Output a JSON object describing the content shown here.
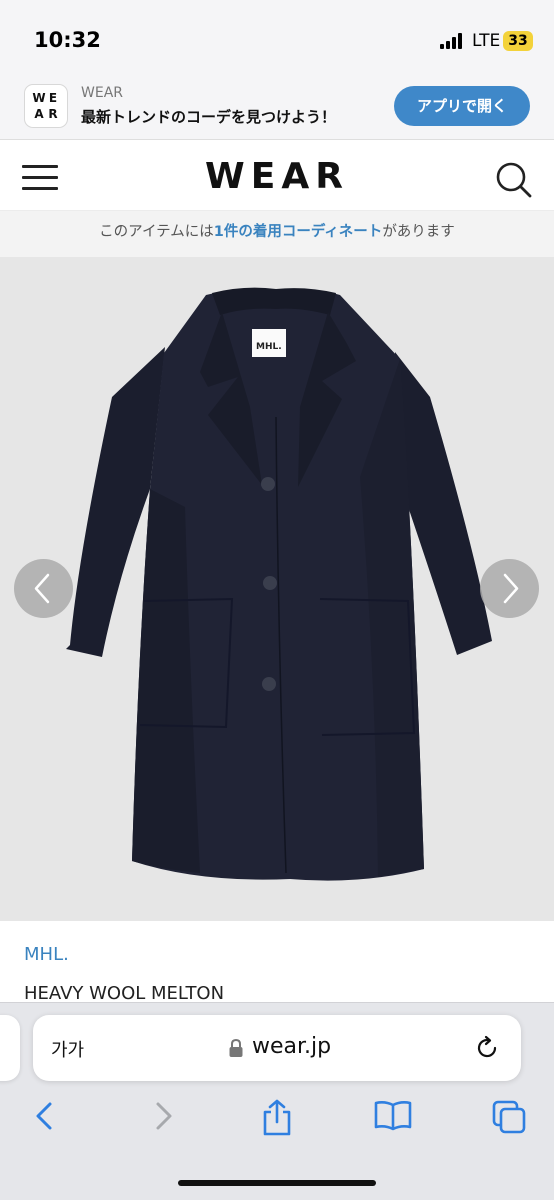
{
  "status_bar": {
    "time": "10:32",
    "network": "LTE",
    "battery": "33"
  },
  "app_banner": {
    "logo_letters": [
      "W",
      "E",
      "A",
      "R"
    ],
    "app_name": "WEAR",
    "tagline": "最新トレンドのコーデを見つけよう！",
    "open_button": "アプリで開く",
    "accent_color": "#3f88c9"
  },
  "header": {
    "logo": "WEAR"
  },
  "notice": {
    "before": "このアイテムには",
    "link": "1件の着用コーディネート",
    "after": "があります"
  },
  "product": {
    "image_label": "MHL.",
    "brand": "MHL.",
    "name": "HEAVY WOOL MELTON",
    "brand_color": "#3a83bf"
  },
  "browser": {
    "text_size_button": "가가",
    "url": "wear.jp"
  },
  "icons": [
    "menu-icon",
    "search-icon",
    "chevron-left-icon",
    "chevron-right-icon",
    "lock-icon",
    "reload-icon",
    "back-icon",
    "forward-icon",
    "share-icon",
    "bookmarks-icon",
    "tabs-icon"
  ]
}
